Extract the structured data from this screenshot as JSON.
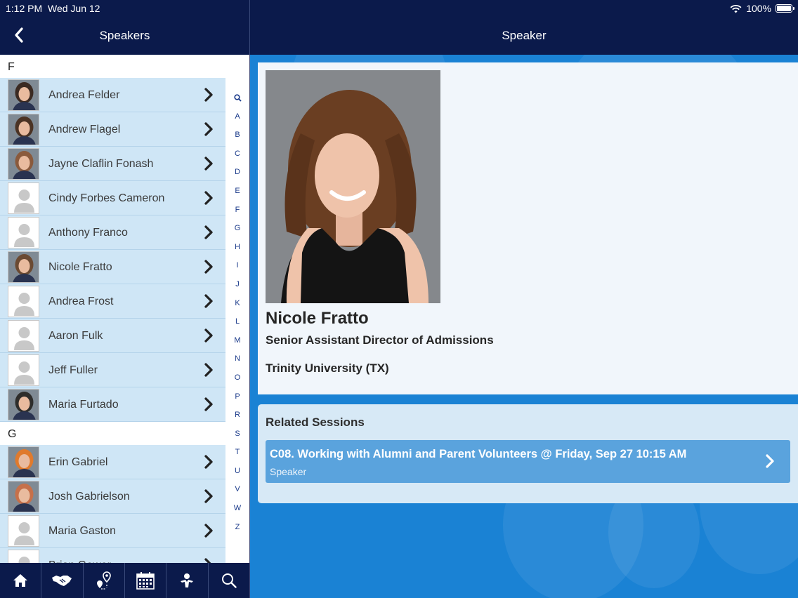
{
  "status": {
    "time": "1:12 PM",
    "date": "Wed Jun 12",
    "battery": "100%"
  },
  "left_header": {
    "title": "Speakers"
  },
  "right_header": {
    "title": "Speaker"
  },
  "sections": [
    {
      "letter": "F",
      "speakers": [
        {
          "name": "Andrea Felder",
          "photo": "photo"
        },
        {
          "name": "Andrew Flagel",
          "photo": "photo"
        },
        {
          "name": "Jayne Claflin Fonash",
          "photo": "photo"
        },
        {
          "name": "Cindy Forbes Cameron",
          "photo": "placeholder"
        },
        {
          "name": "Anthony Franco",
          "photo": "placeholder"
        },
        {
          "name": "Nicole Fratto",
          "photo": "photo"
        },
        {
          "name": "Andrea Frost",
          "photo": "placeholder"
        },
        {
          "name": "Aaron Fulk",
          "photo": "placeholder"
        },
        {
          "name": "Jeff Fuller",
          "photo": "placeholder"
        },
        {
          "name": "Maria Furtado",
          "photo": "photo"
        }
      ]
    },
    {
      "letter": "G",
      "speakers": [
        {
          "name": "Erin Gabriel",
          "photo": "photo"
        },
        {
          "name": "Josh Gabrielson",
          "photo": "photo"
        },
        {
          "name": "Maria Gaston",
          "photo": "placeholder"
        },
        {
          "name": "Brian Gower",
          "photo": "placeholder"
        }
      ]
    }
  ],
  "index_letters": [
    "A",
    "B",
    "C",
    "D",
    "E",
    "F",
    "G",
    "H",
    "I",
    "J",
    "K",
    "L",
    "M",
    "N",
    "O",
    "P",
    "R",
    "S",
    "T",
    "U",
    "V",
    "W",
    "Z"
  ],
  "tabs": [
    "home-icon",
    "handshake-icon",
    "map-pin-icon",
    "calendar-icon",
    "speaker-icon",
    "search-icon"
  ],
  "profile": {
    "name": "Nicole Fratto",
    "role": "Senior Assistant Director of Admissions",
    "org": "Trinity University (TX)"
  },
  "sessions": {
    "title": "Related Sessions",
    "items": [
      {
        "title": "C08. Working with Alumni and Parent Volunteers @ Friday, Sep 27 10:15 AM",
        "subtitle": "Speaker"
      }
    ]
  }
}
